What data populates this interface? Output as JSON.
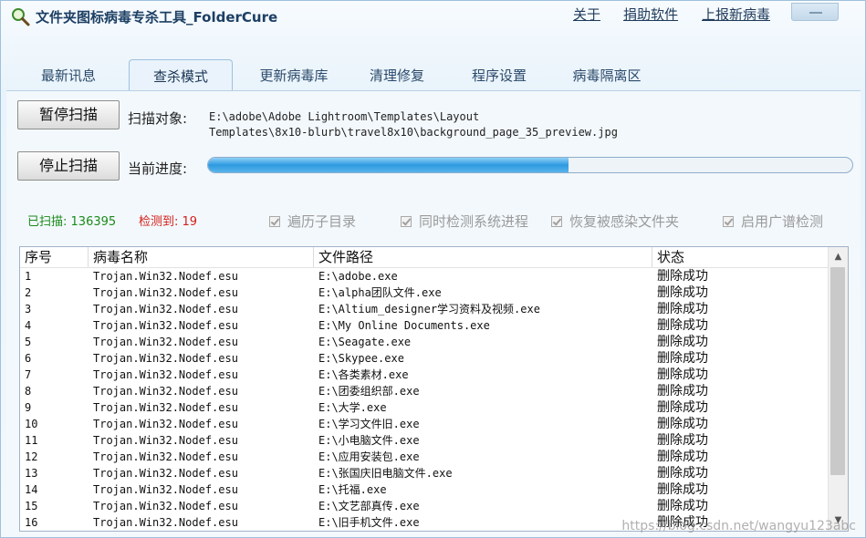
{
  "app": {
    "title": "文件夹图标病毒专杀工具_FolderCure",
    "links": {
      "about": "关于",
      "donate": "捐助软件",
      "report": "上报新病毒"
    }
  },
  "tabs": [
    {
      "label": "最新讯息",
      "active": false
    },
    {
      "label": "查杀模式",
      "active": true
    },
    {
      "label": "更新病毒库",
      "active": false
    },
    {
      "label": "清理修复",
      "active": false
    },
    {
      "label": "程序设置",
      "active": false
    },
    {
      "label": "病毒隔离区",
      "active": false
    }
  ],
  "scan": {
    "pause_label": "暂停扫描",
    "stop_label": "停止扫描",
    "target_label": "扫描对象:",
    "target_line1": "E:\\adobe\\Adobe Lightroom\\Templates\\Layout",
    "target_line2": "Templates\\8x10-blurb\\travel8x10\\background_page_35_preview.jpg",
    "progress_label": "当前进度:",
    "progress_fraction": 0.56
  },
  "stats": {
    "scanned_label": "已扫描:",
    "scanned_value": "136395",
    "detected_label": "检测到:",
    "detected_value": "19"
  },
  "options": [
    {
      "label": "遍历子目录",
      "checked": true
    },
    {
      "label": "同时检测系统进程",
      "checked": true
    },
    {
      "label": "恢复被感染文件夹",
      "checked": true
    },
    {
      "label": "启用广谱检测",
      "checked": true
    }
  ],
  "table": {
    "headers": [
      "序号",
      "病毒名称",
      "文件路径",
      "状态"
    ],
    "rows": [
      [
        "1",
        "Trojan.Win32.Nodef.esu",
        "E:\\adobe.exe",
        "删除成功"
      ],
      [
        "2",
        "Trojan.Win32.Nodef.esu",
        "E:\\alpha团队文件.exe",
        "删除成功"
      ],
      [
        "3",
        "Trojan.Win32.Nodef.esu",
        "E:\\Altium_designer学习资料及视频.exe",
        "删除成功"
      ],
      [
        "4",
        "Trojan.Win32.Nodef.esu",
        "E:\\My Online Documents.exe",
        "删除成功"
      ],
      [
        "5",
        "Trojan.Win32.Nodef.esu",
        "E:\\Seagate.exe",
        "删除成功"
      ],
      [
        "6",
        "Trojan.Win32.Nodef.esu",
        "E:\\Skypee.exe",
        "删除成功"
      ],
      [
        "7",
        "Trojan.Win32.Nodef.esu",
        "E:\\各类素材.exe",
        "删除成功"
      ],
      [
        "8",
        "Trojan.Win32.Nodef.esu",
        "E:\\团委组织部.exe",
        "删除成功"
      ],
      [
        "9",
        "Trojan.Win32.Nodef.esu",
        "E:\\大学.exe",
        "删除成功"
      ],
      [
        "10",
        "Trojan.Win32.Nodef.esu",
        "E:\\学习文件旧.exe",
        "删除成功"
      ],
      [
        "11",
        "Trojan.Win32.Nodef.esu",
        "E:\\小电脑文件.exe",
        "删除成功"
      ],
      [
        "12",
        "Trojan.Win32.Nodef.esu",
        "E:\\应用安装包.exe",
        "删除成功"
      ],
      [
        "13",
        "Trojan.Win32.Nodef.esu",
        "E:\\张国庆旧电脑文件.exe",
        "删除成功"
      ],
      [
        "14",
        "Trojan.Win32.Nodef.esu",
        "E:\\托福.exe",
        "删除成功"
      ],
      [
        "15",
        "Trojan.Win32.Nodef.esu",
        "E:\\文艺部真传.exe",
        "删除成功"
      ],
      [
        "16",
        "Trojan.Win32.Nodef.esu",
        "E:\\旧手机文件.exe",
        "删除成功"
      ]
    ]
  },
  "watermark": "https://blog.csdn.net/wangyu123abc",
  "colors": {
    "scanned": "#1a8a1a",
    "detected": "#d4201a",
    "accent": "#2e9ae0"
  },
  "icons": {
    "app": "magnifier-icon",
    "scroll_up": "chevron-up-icon",
    "scroll_down": "chevron-down-icon"
  }
}
